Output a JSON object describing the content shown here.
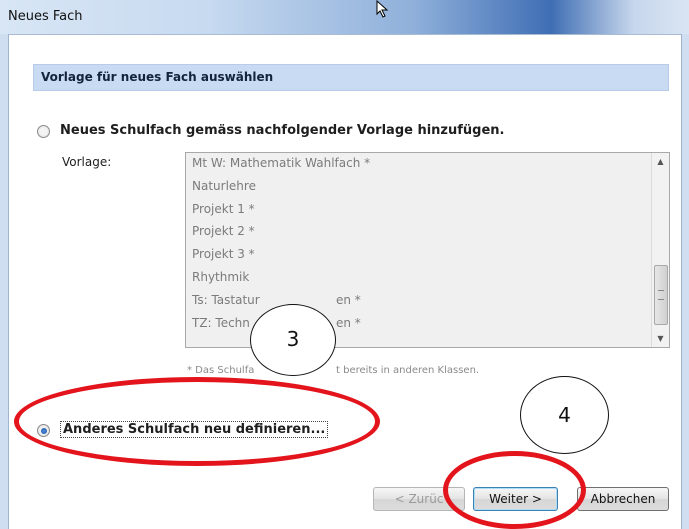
{
  "window": {
    "title": "Neues Fach"
  },
  "section": {
    "heading": "Vorlage für neues Fach auswählen"
  },
  "option_template": {
    "label": "Neues Schulfach gemäss nachfolgender Vorlage hinzufügen.",
    "selected": false
  },
  "template": {
    "label": "Vorlage:",
    "items": [
      "Mt W: Mathematik Wahlfach *",
      "Naturlehre",
      "Projekt 1 *",
      "Projekt 2 *",
      "Projekt 3 *",
      "Rhythmik",
      "Ts: Tastatur",
      "en *",
      "TZ: Techn",
      "en *"
    ]
  },
  "note": {
    "part1": "* Das Schulfa",
    "part2": "t bereits in anderen Klassen."
  },
  "option_define": {
    "label": "Anderes Schulfach neu definieren...",
    "selected": true
  },
  "buttons": {
    "back": "< Zurüc",
    "next": "Weiter >",
    "cancel": "Abbrechen"
  },
  "annotations": {
    "marker_3": "3",
    "marker_4": "4",
    "highlight_color": "#e3141b"
  }
}
